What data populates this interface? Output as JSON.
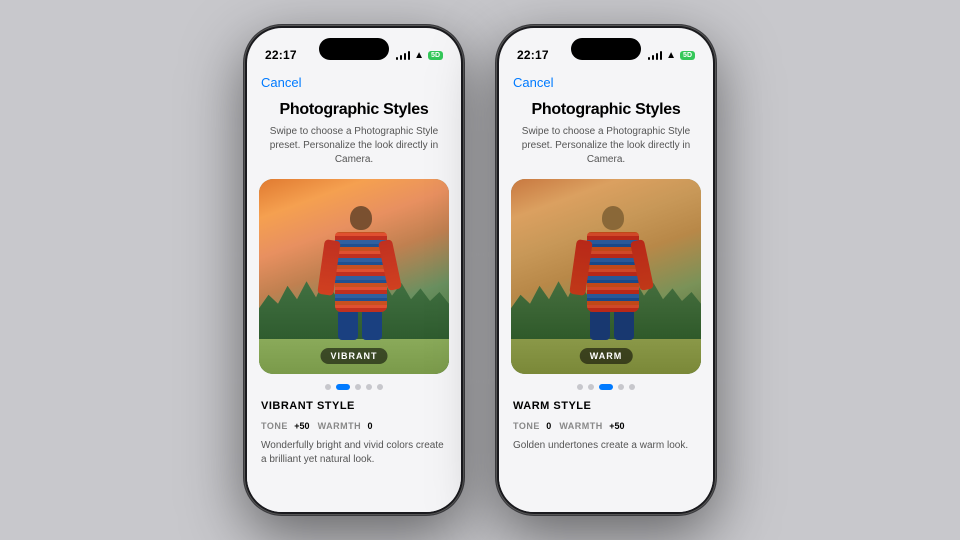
{
  "background": "#c8c8cc",
  "phones": [
    {
      "id": "vibrant",
      "status": {
        "time": "22:17",
        "battery_label": "5D"
      },
      "cancel_label": "Cancel",
      "title": "Photographic Styles",
      "subtitle": "Swipe to choose a Photographic Style preset. Personalize the look directly in Camera.",
      "style_badge": "VIBRANT",
      "dots": [
        false,
        true,
        false,
        false,
        false
      ],
      "style_name": "VIBRANT STYLE",
      "tone_label": "TONE",
      "tone_value": "+50",
      "warmth_label": "WARMTH",
      "warmth_value": "0",
      "description": "Wonderfully bright and vivid colors create a brilliant yet natural look."
    },
    {
      "id": "warm",
      "status": {
        "time": "22:17",
        "battery_label": "5D"
      },
      "cancel_label": "Cancel",
      "title": "Photographic Styles",
      "subtitle": "Swipe to choose a Photographic Style preset. Personalize the look directly in Camera.",
      "style_badge": "WARM",
      "dots": [
        false,
        false,
        true,
        false,
        false
      ],
      "style_name": "WARM STYLE",
      "tone_label": "TONE",
      "tone_value": "0",
      "warmth_label": "WARMTH",
      "warmth_value": "+50",
      "description": "Golden undertones create a warm look."
    }
  ]
}
